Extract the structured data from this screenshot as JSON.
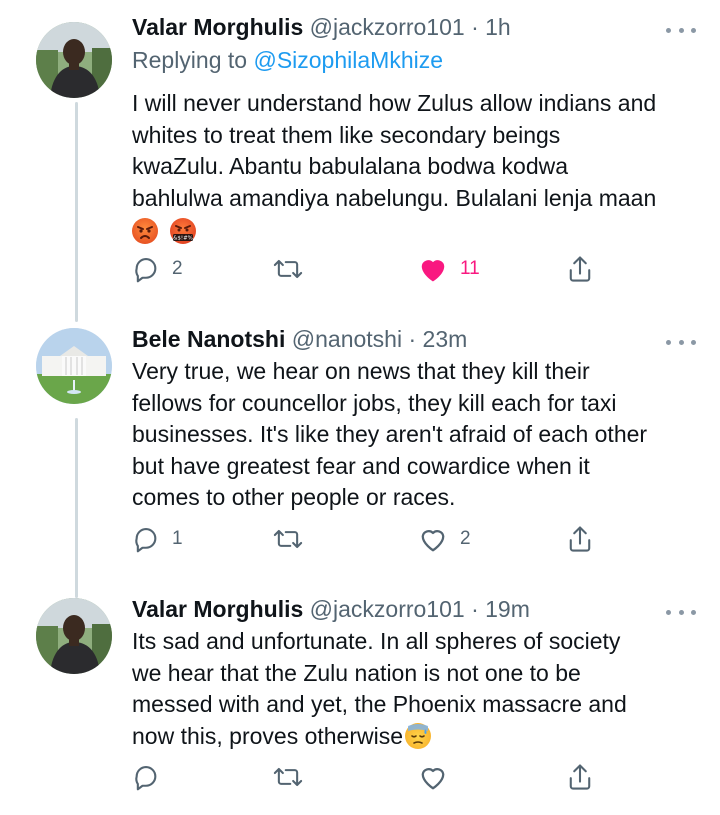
{
  "tweets": [
    {
      "name": "Valar Morghulis",
      "handle": "@jackzorro101",
      "separator": "·",
      "time": "1h",
      "replying_prefix": "Replying to ",
      "replying_to": "@SizophilaMkhize",
      "lines": [
        "I will never understand how Zulus allow indians and",
        "whites to treat them like secondary beings",
        "kwaZulu. Abantu babulalana bodwa kodwa",
        "bahlulwa amandiya nabelungu. Bulalani lenja maan"
      ],
      "emojis": [
        "angry-face-emoji",
        "face-with-symbols-on-mouth-emoji"
      ],
      "emoji_symbols_text": "&$!#%",
      "reply_count": "2",
      "retweet_count": "",
      "like_count": "11",
      "liked": true,
      "avatar_icon": "person-photo"
    },
    {
      "name": "Bele Nanotshi",
      "handle": "@nanotshi",
      "separator": "·",
      "time": "23m",
      "lines": [
        "Very true, we hear on news that they kill their",
        "fellows for councellor jobs, they kill each for taxi",
        "businesses. It's like they aren't afraid of each other",
        "but have greatest fear and cowardice when it",
        "comes to other people or races."
      ],
      "reply_count": "1",
      "retweet_count": "",
      "like_count": "2",
      "liked": false,
      "avatar_icon": "white-house-photo"
    },
    {
      "name": "Valar Morghulis",
      "handle": "@jackzorro101",
      "separator": "·",
      "time": "19m",
      "lines": [
        "Its sad and unfortunate. In all spheres of society",
        "we hear that the Zulu nation is not one to be",
        "messed with and yet, the Phoenix massacre and",
        "now this, proves otherwise"
      ],
      "emojis": [
        "downcast-face-with-sweat-emoji"
      ],
      "reply_count": "",
      "retweet_count": "",
      "like_count": "",
      "liked": false,
      "avatar_icon": "person-photo"
    }
  ],
  "colors": {
    "text": "#0f1419",
    "secondary": "#536471",
    "link": "#1d9bf0",
    "like_active": "#f91880",
    "thread_line": "#cfd9de"
  }
}
